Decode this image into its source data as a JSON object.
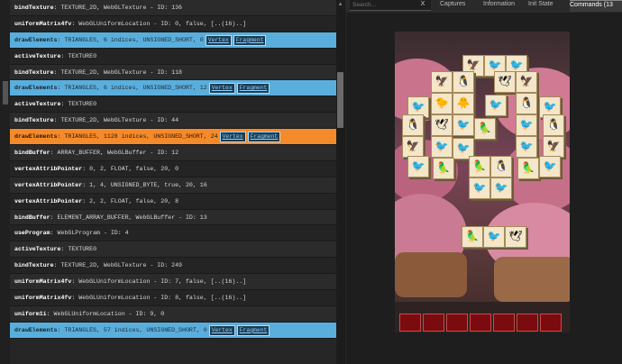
{
  "command_list": [
    {
      "kind": "alt",
      "name": "bindTexture",
      "args": "TEXTURE_2D, WebGLTexture - ID: 136"
    },
    {
      "kind": "plain",
      "name": "uniformMatrix4fv",
      "args": "WebGLUniformLocation - ID: 0, false, [..(16)..]"
    },
    {
      "kind": "draw",
      "name": "drawElements",
      "args": "TRIANGLES, 6 indices, UNSIGNED_SHORT, 0",
      "links": [
        "Vertex",
        "Fragment"
      ]
    },
    {
      "kind": "plain",
      "name": "activeTexture",
      "args": "TEXTURE0"
    },
    {
      "kind": "alt",
      "name": "bindTexture",
      "args": "TEXTURE_2D, WebGLTexture - ID: 118"
    },
    {
      "kind": "draw",
      "name": "drawElements",
      "args": "TRIANGLES, 6 indices, UNSIGNED_SHORT, 12",
      "links": [
        "Vertex",
        "Fragment"
      ]
    },
    {
      "kind": "plain",
      "name": "activeTexture",
      "args": "TEXTURE0"
    },
    {
      "kind": "alt",
      "name": "bindTexture",
      "args": "TEXTURE_2D, WebGLTexture - ID: 44"
    },
    {
      "kind": "sel",
      "name": "drawElements",
      "args": "TRIANGLES, 1128 indices, UNSIGNED_SHORT, 24",
      "links": [
        "Vertex",
        "Fragment"
      ]
    },
    {
      "kind": "alt",
      "name": "bindBuffer",
      "args": "ARRAY_BUFFER, WebGLBuffer - ID: 12"
    },
    {
      "kind": "plain",
      "name": "vertexAttribPointer",
      "args": "0, 2, FLOAT, false, 20, 0"
    },
    {
      "kind": "alt",
      "name": "vertexAttribPointer",
      "args": "1, 4, UNSIGNED_BYTE, true, 20, 16"
    },
    {
      "kind": "plain",
      "name": "vertexAttribPointer",
      "args": "2, 2, FLOAT, false, 20, 8"
    },
    {
      "kind": "alt",
      "name": "bindBuffer",
      "args": "ELEMENT_ARRAY_BUFFER, WebGLBuffer - ID: 13"
    },
    {
      "kind": "plain",
      "name": "useProgram",
      "args": "WebGLProgram - ID: 4"
    },
    {
      "kind": "alt",
      "name": "activeTexture",
      "args": "TEXTURE0"
    },
    {
      "kind": "plain",
      "name": "bindTexture",
      "args": "TEXTURE_2D, WebGLTexture - ID: 249"
    },
    {
      "kind": "alt",
      "name": "uniformMatrix4fv",
      "args": "WebGLUniformLocation - ID: 7, false, [..(16)..]"
    },
    {
      "kind": "plain",
      "name": "uniformMatrix4fv",
      "args": "WebGLUniformLocation - ID: 8, false, [..(16)..]"
    },
    {
      "kind": "alt",
      "name": "uniform1i",
      "args": "WebGLUniformLocation - ID: 9, 0"
    },
    {
      "kind": "draw",
      "name": "drawElements",
      "args": "TRIANGLES, 57 indices, UNSIGNED_SHORT, 0",
      "links": [
        "Vertex",
        "Fragment"
      ]
    }
  ],
  "right_panel": {
    "search": {
      "placeholder": "Search...",
      "close_label": "X"
    },
    "tabs": {
      "captures": "Captures",
      "information": "Information",
      "init_state": "Init State",
      "commands": "Commands (13"
    }
  },
  "colors": {
    "draw_row": "#5aaedc",
    "selected_row": "#f58a2a",
    "slot": "#7a0b0e"
  }
}
